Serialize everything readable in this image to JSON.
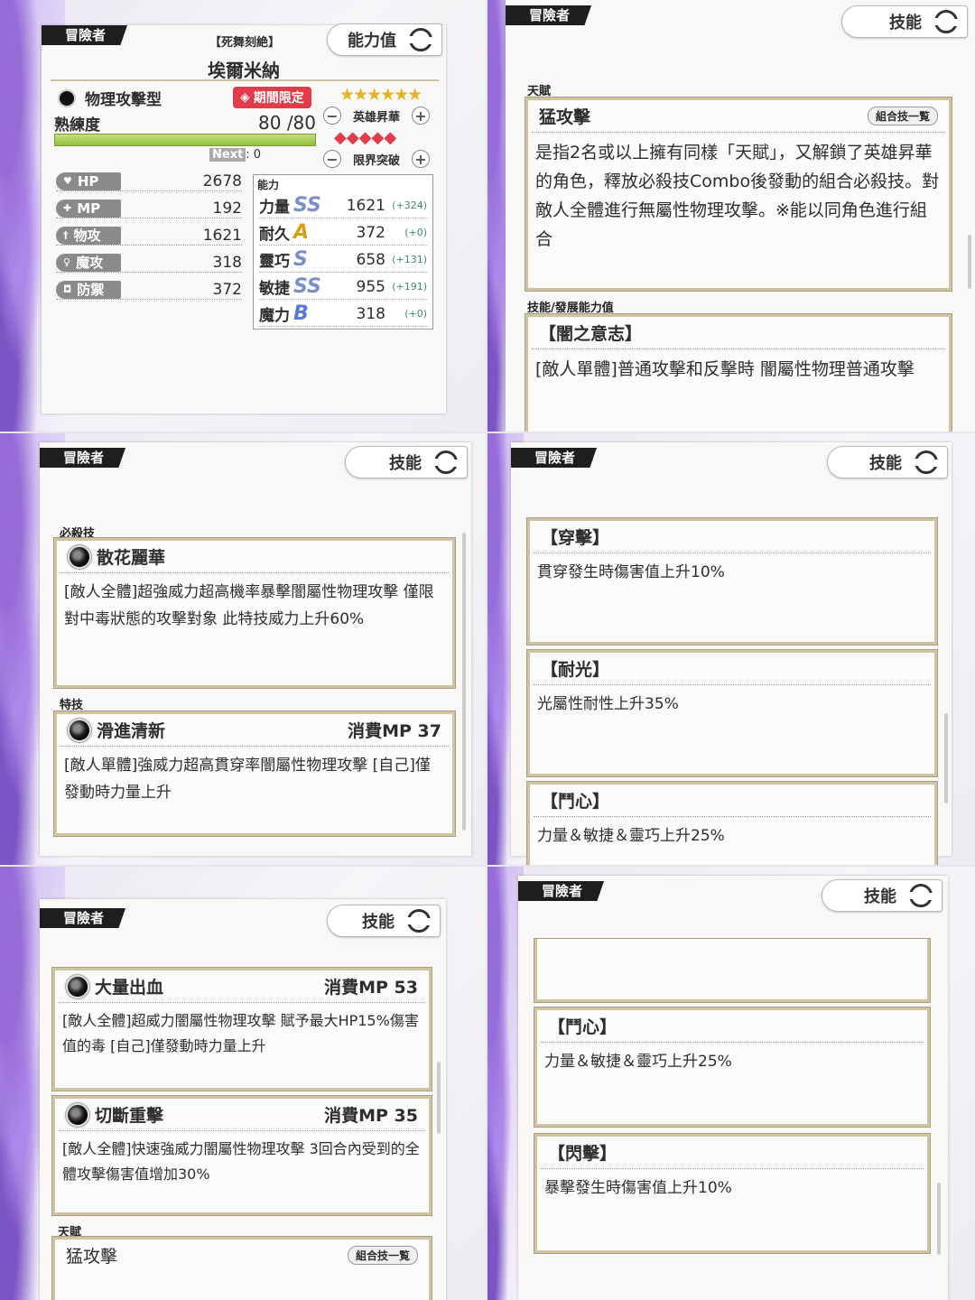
{
  "header": {
    "tag": "冒險者",
    "subtitle": "【死舞刻絶】",
    "name": "埃爾米納",
    "switch_stats": "能力值",
    "switch_skills": "技能"
  },
  "char": {
    "type": "物理攻擊型",
    "limited": "期間限定",
    "proficiency_label": "熟練度",
    "proficiency": "80",
    "proficiency_max": "/80",
    "next_label": "Next",
    "next_value": ": 0",
    "hero_label": "英雄昇華",
    "limit_label": "限界突破",
    "stars": 6,
    "hero_level": 5
  },
  "stats": [
    {
      "label": "HP",
      "icon": "heart-icon",
      "value": "2678"
    },
    {
      "label": "MP",
      "icon": "mp-icon",
      "value": "192"
    },
    {
      "label": "物攻",
      "icon": "sword-icon",
      "value": "1621"
    },
    {
      "label": "魔攻",
      "icon": "magic-icon",
      "value": "318"
    },
    {
      "label": "防禦",
      "icon": "shield-icon",
      "value": "372"
    }
  ],
  "ability": {
    "title": "能力",
    "rows": [
      {
        "name": "力量",
        "rank": "SS",
        "value": "1621",
        "bonus": "(+324)"
      },
      {
        "name": "耐久",
        "rank": "A",
        "value": "372",
        "bonus": "(+0)"
      },
      {
        "name": "靈巧",
        "rank": "S",
        "value": "658",
        "bonus": "(+131)"
      },
      {
        "name": "敏捷",
        "rank": "SS",
        "value": "955",
        "bonus": "(+191)"
      },
      {
        "name": "魔力",
        "rank": "B",
        "value": "318",
        "bonus": "(+0)"
      }
    ]
  },
  "talent": {
    "label": "天賦",
    "name": "猛攻擊",
    "combo": "組合技一覧",
    "desc": "是指2名或以上擁有同樣「天賦」，又解鎖了英雄昇華的角色，釋放必殺技Combo後發動的組合必殺技。對敵人全體進行無屬性物理攻擊。※能以同角色進行組合"
  },
  "dev_label": "技能/發展能力值",
  "dev": {
    "dark": {
      "name": "【闇之意志】",
      "desc": "[敵人單體]普通攻擊和反擊時 闇屬性物理普通攻擊"
    },
    "pierce": {
      "name": "【穿擊】",
      "desc": "貫穿發生時傷害值上升10%"
    },
    "light": {
      "name": "【耐光】",
      "desc": "光屬性耐性上升35%"
    },
    "fight": {
      "name": "【鬥心】",
      "desc": "力量＆敏捷＆靈巧上升25%"
    },
    "flash": {
      "name": "【閃擊】",
      "desc": "暴擊發生時傷害值上升10%"
    }
  },
  "special": {
    "label": "必殺技",
    "name": "散花麗華",
    "desc": "[敵人全體]超強威力超高機率暴擊闇屬性物理攻擊 僅限對中毒狀態的攻擊對象 此特技威力上升60%"
  },
  "skills_label": "特技",
  "skills": [
    {
      "name": "滑進清新",
      "mp": "消費MP 37",
      "desc": "[敵人單體]強威力超高貫穿率闇屬性物理攻擊 [自己]僅發動時力量上升"
    },
    {
      "name": "大量出血",
      "mp": "消費MP 53",
      "desc": "[敵人全體]超威力闇屬性物理攻擊 賦予最大HP15%傷害值的毒 [自己]僅發動時力量上升"
    },
    {
      "name": "切斷重擊",
      "mp": "消費MP 35",
      "desc": "[敵人全體]快速強威力闇屬性物理攻擊 3回合內受到的全體攻擊傷害值增加30%"
    }
  ],
  "colors": {
    "accent": "#e23b4a",
    "gold": "#cfc3a1",
    "purple": "#8d5fd6"
  }
}
